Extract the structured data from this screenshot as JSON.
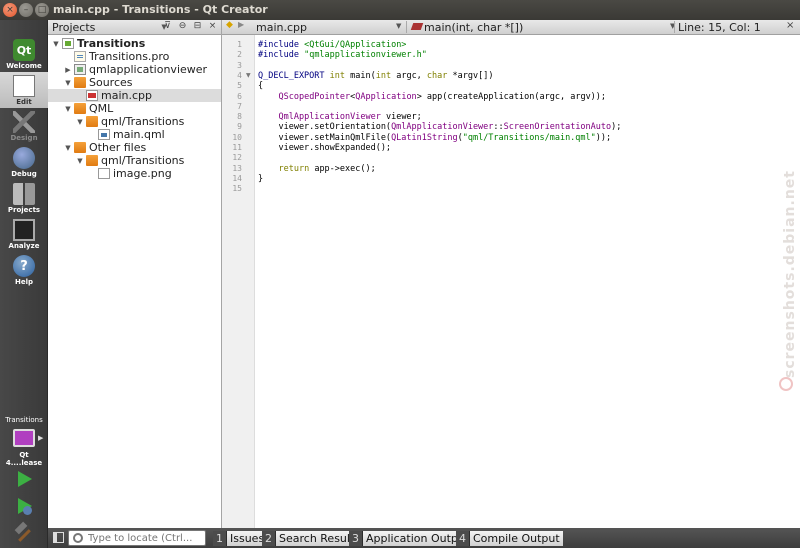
{
  "window": {
    "title": "main.cpp - Transitions - Qt Creator"
  },
  "modes": [
    {
      "label": "Welcome",
      "icon": "qt-logo-icon",
      "logo_text": "Qt"
    },
    {
      "label": "Edit",
      "icon": "edit-icon"
    },
    {
      "label": "Design",
      "icon": "design-icon"
    },
    {
      "label": "Debug",
      "icon": "debug-icon"
    },
    {
      "label": "Projects",
      "icon": "projects-icon"
    },
    {
      "label": "Analyze",
      "icon": "analyze-icon"
    },
    {
      "label": "Help",
      "icon": "help-icon",
      "glyph": "?"
    }
  ],
  "target": {
    "project": "Transitions",
    "kit": "Qt 4....lease"
  },
  "projects_panel": {
    "title": "Projects",
    "tree": [
      {
        "label": "Transitions",
        "depth": 0,
        "arrow": "▼",
        "icon": "project-icon",
        "bold": true
      },
      {
        "label": "Transitions.pro",
        "depth": 1,
        "arrow": "",
        "icon": "pro-file-icon"
      },
      {
        "label": "qmlapplicationviewer",
        "depth": 1,
        "arrow": "▶",
        "icon": "pri-group-icon"
      },
      {
        "label": "Sources",
        "depth": 1,
        "arrow": "▼",
        "icon": "folder-icon"
      },
      {
        "label": "main.cpp",
        "depth": 2,
        "arrow": "",
        "icon": "cpp-file-icon",
        "selected": true
      },
      {
        "label": "QML",
        "depth": 1,
        "arrow": "▼",
        "icon": "folder-icon"
      },
      {
        "label": "qml/Transitions",
        "depth": 2,
        "arrow": "▼",
        "icon": "folder-icon"
      },
      {
        "label": "main.qml",
        "depth": 3,
        "arrow": "",
        "icon": "qml-file-icon"
      },
      {
        "label": "Other files",
        "depth": 1,
        "arrow": "▼",
        "icon": "folder-icon"
      },
      {
        "label": "qml/Transitions",
        "depth": 2,
        "arrow": "▼",
        "icon": "folder-icon"
      },
      {
        "label": "image.png",
        "depth": 3,
        "arrow": "",
        "icon": "image-file-icon"
      }
    ]
  },
  "editor_toolbar": {
    "file": "main.cpp",
    "function": "main(int, char *[])",
    "position": "Line: 15, Col: 1"
  },
  "code_lines": [
    {
      "n": "1",
      "fold": "",
      "html": "<span class=\"mac\">#include</span> <span class=\"str\">&lt;QtGui/QApplication&gt;</span>"
    },
    {
      "n": "2",
      "fold": "",
      "html": "<span class=\"mac\">#include</span> <span class=\"str\">\"qmlapplicationviewer.h\"</span>"
    },
    {
      "n": "3",
      "fold": "",
      "html": ""
    },
    {
      "n": "4",
      "fold": "▼",
      "html": "<span class=\"mac\">Q_DECL_EXPORT</span> <span class=\"kw\">int</span> main(<span class=\"kw\">int</span> argc, <span class=\"kw\">char</span> *argv[])"
    },
    {
      "n": "5",
      "fold": "",
      "html": "{"
    },
    {
      "n": "6",
      "fold": "",
      "html": "    <span class=\"cls\">QScopedPointer</span>&lt;<span class=\"cls\">QApplication</span>&gt; app(createApplication(argc, argv));"
    },
    {
      "n": "7",
      "fold": "",
      "html": ""
    },
    {
      "n": "8",
      "fold": "",
      "html": "    <span class=\"cls\">QmlApplicationViewer</span> viewer;"
    },
    {
      "n": "9",
      "fold": "",
      "html": "    viewer.setOrientation(<span class=\"cls\">QmlApplicationViewer</span>::<span class=\"cls\">ScreenOrientationAuto</span>);"
    },
    {
      "n": "10",
      "fold": "",
      "html": "    viewer.setMainQmlFile(<span class=\"cls\">QLatin1String</span>(<span class=\"str\">\"qml/Transitions/main.qml\"</span>));"
    },
    {
      "n": "11",
      "fold": "",
      "html": "    viewer.showExpanded();"
    },
    {
      "n": "12",
      "fold": "",
      "html": ""
    },
    {
      "n": "13",
      "fold": "",
      "html": "    <span class=\"kw\">return</span> app-&gt;exec();"
    },
    {
      "n": "14",
      "fold": "",
      "html": "}"
    },
    {
      "n": "15",
      "fold": "",
      "html": ""
    }
  ],
  "locator": {
    "placeholder": "Type to locate (Ctrl..."
  },
  "output_tabs": [
    {
      "num": "1",
      "label": "Issues"
    },
    {
      "num": "2",
      "label": "Search Results"
    },
    {
      "num": "3",
      "label": "Application Output"
    },
    {
      "num": "4",
      "label": "Compile Output"
    }
  ],
  "watermark": "screenshots.debian.net"
}
